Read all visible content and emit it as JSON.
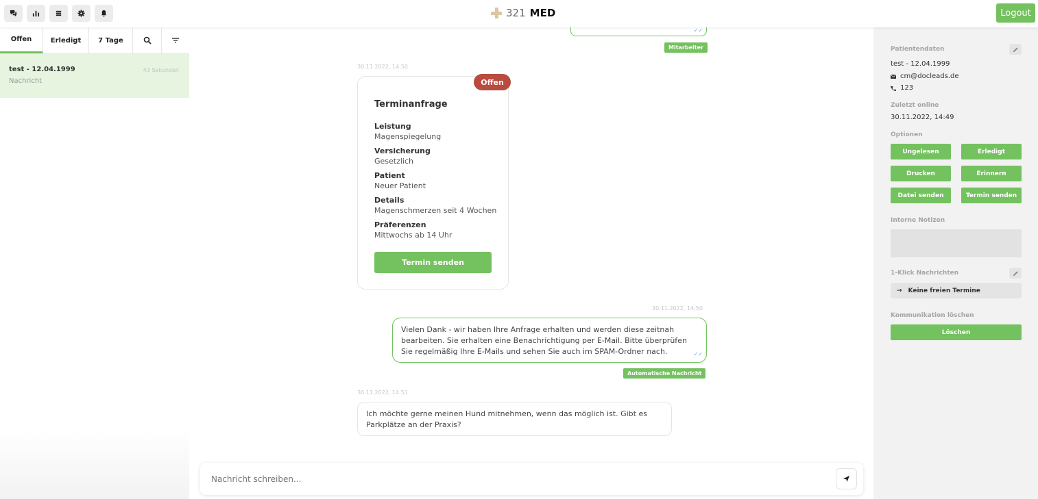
{
  "topbar": {
    "icons": [
      "chat-icon",
      "stats-icon",
      "list-icon",
      "gear-icon",
      "bell-icon"
    ],
    "brand_number": "321",
    "brand_name": "MED",
    "logout_label": "Logout"
  },
  "sidebar": {
    "tabs": [
      {
        "label": "Offen"
      },
      {
        "label": "Erledigt"
      },
      {
        "label": "7 Tage"
      }
    ],
    "conversations": [
      {
        "title": "test - 12.04.1999",
        "subtitle": "Nachricht",
        "time": "43 Sekunden"
      }
    ]
  },
  "chat": {
    "top_tag": "Mitarbeiter",
    "card_timestamp": "30.11.2022, 14:50",
    "card": {
      "status": "Offen",
      "title": "Terminanfrage",
      "fields": [
        {
          "label": "Leistung",
          "value": "Magenspiegelung"
        },
        {
          "label": "Versicherung",
          "value": "Gesetzlich"
        },
        {
          "label": "Patient",
          "value": "Neuer Patient"
        },
        {
          "label": "Details",
          "value": "Magenschmerzen seit 4 Wochen"
        },
        {
          "label": "Präferenzen",
          "value": "Mittwochs ab 14 Uhr"
        }
      ],
      "button": "Termin senden"
    },
    "auto_timestamp": "30.11.2022, 14:50",
    "auto_message": "Vielen Dank - wir haben Ihre Anfrage erhalten und werden diese zeitnah bearbeiten. Sie erhalten eine Benachrichtigung per E-Mail. Bitte überprüfen Sie regelmäßig Ihre E-Mails und sehen Sie auch im SPAM-Ordner nach.",
    "auto_tag": "Automatische Nachricht",
    "patient_timestamp": "30.11.2022, 14:51",
    "patient_message": "Ich möchte gerne meinen Hund mitnehmen, wenn das möglich ist. Gibt es Parkplätze an der Praxis?",
    "composer_placeholder": "Nachricht schreiben..."
  },
  "panel": {
    "patient_label": "Patientendaten",
    "patient_name": "test  -  12.04.1999",
    "email": "cm@docleads.de",
    "phone": "123",
    "last_online_label": "Zuletzt online",
    "last_online": "30.11.2022, 14:49",
    "options_label": "Optionen",
    "options": [
      "Ungelesen",
      "Erledigt",
      "Drucken",
      "Erinnern",
      "Datei senden",
      "Termin senden"
    ],
    "notes_label": "Interne Notizen",
    "oneclick_label": "1-Klick Nachrichten",
    "oneclick_item": "Keine freien Termine",
    "delete_label": "Kommunikation löschen",
    "delete_button": "Löschen"
  },
  "colors": {
    "accent": "#74c15f",
    "status_open": "#b94b3f",
    "selected_row": "#e6f4e0"
  }
}
